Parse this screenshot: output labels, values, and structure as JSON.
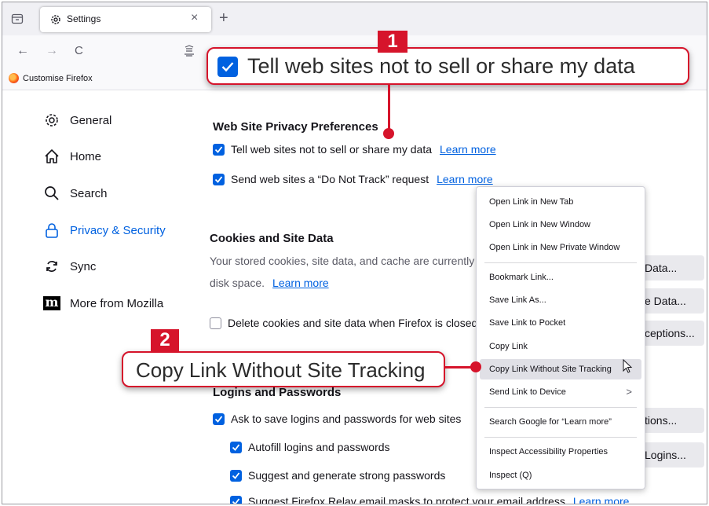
{
  "tab": {
    "title": "Settings",
    "close": "×",
    "new_tab": "+"
  },
  "nav": {
    "back": "←",
    "forward": "→",
    "reload": "C"
  },
  "bookmarks": {
    "item": "Customise Firefox"
  },
  "sidebar": {
    "items": [
      {
        "label": "General",
        "icon": "gear-icon"
      },
      {
        "label": "Home",
        "icon": "home-icon"
      },
      {
        "label": "Search",
        "icon": "search-icon"
      },
      {
        "label": "Privacy & Security",
        "icon": "lock-icon",
        "active": true
      },
      {
        "label": "Sync",
        "icon": "sync-icon"
      },
      {
        "label": "More from Mozilla",
        "icon": "mozilla-icon"
      }
    ]
  },
  "privacy": {
    "heading": "Web Site Privacy Preferences",
    "sell_label": "Tell web sites not to sell or share my data",
    "sell_link": "Learn more",
    "dnt_label": "Send web sites a “Do Not Track” request",
    "dnt_link": "Learn more"
  },
  "cookies": {
    "heading": "Cookies and Site Data",
    "desc1": "Your stored cookies, site data, and cache are currently",
    "desc2": "disk space.",
    "link": "Learn more",
    "delete_label": "Delete cookies and site data when Firefox is closed",
    "btn1": "Data...",
    "btn2": "e Data...",
    "btn3": "ceptions..."
  },
  "logins": {
    "heading": "Logins and Passwords",
    "ask_label": "Ask to save logins and passwords for web sites",
    "autofill_label": "Autofill logins and passwords",
    "suggest_label": "Suggest and generate strong passwords",
    "relay_label": "Suggest Firefox Relay email masks to protect your email address",
    "relay_link": "Learn more",
    "btn1": "tions...",
    "btn2": "Logins..."
  },
  "context_menu": {
    "items": [
      "Open Link in New Tab",
      "Open Link in New Window",
      "Open Link in New Private Window",
      "Bookmark Link...",
      "Save Link As...",
      "Save Link to Pocket",
      "Copy Link",
      "Copy Link Without Site Tracking",
      "Send Link to Device",
      "Search Google for “Learn more”",
      "Inspect Accessibility Properties",
      "Inspect (Q)"
    ],
    "submenu_arrow": ">"
  },
  "callouts": {
    "one": {
      "badge": "1",
      "text": "Tell web sites not to sell or share my data"
    },
    "two": {
      "badge": "2",
      "text": "Copy Link Without Site Tracking"
    }
  },
  "colors": {
    "accent": "#0061e0",
    "callout_red": "#d6142b"
  }
}
